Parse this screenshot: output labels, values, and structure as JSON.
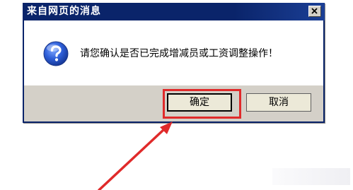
{
  "window": {
    "title": "来自网页的消息",
    "close_icon": "close-icon"
  },
  "message": {
    "icon": "question-icon",
    "text": "请您确认是否已完成增减员或工资调整操作！"
  },
  "buttons": {
    "ok_label": "确定",
    "cancel_label": "取消"
  },
  "annotation": {
    "highlight_color": "#e02a2a",
    "arrow_color": "#e02a2a"
  }
}
